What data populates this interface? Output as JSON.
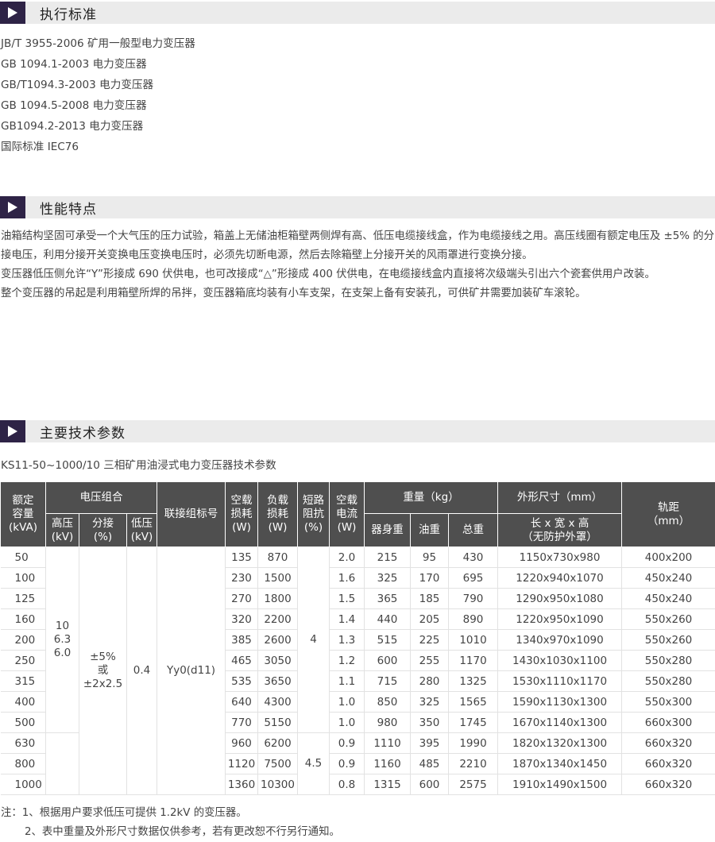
{
  "sections": {
    "standards": "执行标准",
    "features": "性能特点",
    "params": "主要技术参数"
  },
  "standards": [
    "JB/T 3955-2006 矿用一般型电力变压器",
    "GB 1094.1-2003 电力变压器",
    "GB/T1094.3-2003 电力变压器",
    "GB 1094.5-2008 电力变压器",
    "GB1094.2-2013 电力变压器",
    "国际标准 IEC76"
  ],
  "features": [
    "油箱结构坚固可承受一个大气压的压力试验，箱盖上无储油柜箱壁两侧焊有高、低压电缆接线盒，作为电缆接线之用。高压线圈有额定电压及 ±5% 的分接电压，利用分接开关变换电压变换电压时，必须先切断电源，然后去除箱壁上分接开关的风雨罩进行变换分接。",
    "变压器低压侧允许“Y”形接成 690 伏供电，也可改接成“△”形接成 400 伏供电，在电缆接线盒内直接将次级端头引出六个瓷套供用户改装。",
    "整个变压器的吊起是利用箱壁所焊的吊拌，变压器箱底均装有小车支架，在支架上备有安装孔，可供矿井需要加装矿车滚轮。"
  ],
  "table": {
    "caption": "KS11-50~1000/10 三相矿用油浸式电力变压器技术参数",
    "headers": {
      "capacity": [
        "额定",
        "容量",
        "(kVA)"
      ],
      "voltage_group": "电压组合",
      "hv": [
        "高压",
        "(kV)"
      ],
      "tap": [
        "分接",
        "(%)"
      ],
      "lv": [
        "低压",
        "(kV)"
      ],
      "connection": "联接组标号",
      "noload_loss": [
        "空载",
        "损耗",
        "(W)"
      ],
      "load_loss": [
        "负载",
        "损耗",
        "(W)"
      ],
      "impedance": [
        "短路",
        "阻抗",
        "(%)"
      ],
      "noload_current": [
        "空载",
        "电流",
        "(W)"
      ],
      "weight": "重量（kg）",
      "body_weight": "器身重",
      "oil_weight": "油重",
      "total_weight": "总重",
      "dimensions": "外形尺寸（mm）",
      "dim_detail": [
        "长 x 宽 x 高",
        "（无防护外罩）"
      ],
      "gauge": [
        "轨距",
        "（mm）"
      ]
    },
    "merged": {
      "hv": [
        "10",
        "6.3",
        "6.0"
      ],
      "tap": [
        "±5%",
        "或",
        "±2x2.5"
      ],
      "lv": "0.4",
      "connection": "Yy0(d11)",
      "impedance_a": "4",
      "impedance_b": "4.5"
    },
    "rows": [
      [
        "50",
        "135",
        "870",
        "2.0",
        "215",
        "95",
        "430",
        "1150x730x980",
        "400x200"
      ],
      [
        "100",
        "230",
        "1500",
        "1.6",
        "325",
        "170",
        "695",
        "1220x940x1070",
        "450x240"
      ],
      [
        "125",
        "270",
        "1800",
        "1.5",
        "365",
        "185",
        "790",
        "1290x950x1080",
        "450x240"
      ],
      [
        "160",
        "320",
        "2200",
        "1.4",
        "440",
        "205",
        "890",
        "1220x950x1090",
        "550x260"
      ],
      [
        "200",
        "385",
        "2600",
        "1.3",
        "515",
        "225",
        "1010",
        "1340x970x1090",
        "550x260"
      ],
      [
        "250",
        "465",
        "3050",
        "1.2",
        "600",
        "255",
        "1170",
        "1430x1030x1100",
        "550x280"
      ],
      [
        "315",
        "535",
        "3650",
        "1.1",
        "715",
        "280",
        "1325",
        "1530x1110x1170",
        "550x280"
      ],
      [
        "400",
        "640",
        "4300",
        "1.0",
        "850",
        "325",
        "1565",
        "1590x1130x1300",
        "550x300"
      ],
      [
        "500",
        "770",
        "5150",
        "1.0",
        "980",
        "350",
        "1745",
        "1670x1140x1300",
        "660x300"
      ],
      [
        "630",
        "960",
        "6200",
        "0.9",
        "1110",
        "395",
        "1990",
        "1820x1320x1300",
        "660x320"
      ],
      [
        "800",
        "1120",
        "7500",
        "0.9",
        "1160",
        "485",
        "2210",
        "1870x1340x1450",
        "660x320"
      ],
      [
        "1000",
        "1360",
        "10300",
        "0.8",
        "1315",
        "600",
        "2575",
        "1910x1490x1500",
        "660x320"
      ]
    ]
  },
  "notes": [
    "注：1、根据用户要求低压可提供 1.2kV 的变压器。",
    "2、表中重量及外形尺寸数据仅供参考，若有更改恕不行另行通知。"
  ]
}
